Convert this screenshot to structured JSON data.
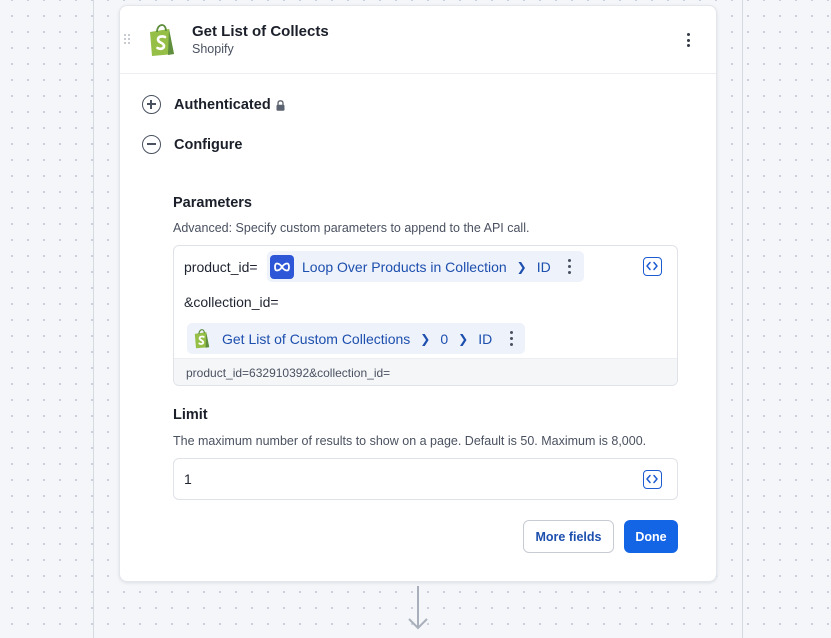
{
  "step": {
    "title": "Get List of Collects",
    "app": "Shopify",
    "menu_icon": "kebab-icon"
  },
  "sections": {
    "authenticated": {
      "label": "Authenticated",
      "state": "collapsed",
      "icon": "lock-icon"
    },
    "configure": {
      "label": "Configure",
      "state": "expanded"
    }
  },
  "parameters": {
    "label": "Parameters",
    "help": "Advanced: Specify custom parameters to append to the API call.",
    "prefix_product": "product_id=",
    "pill1": {
      "icon": "loop-icon",
      "label": "Loop Over Products in Collection",
      "path": [
        "ID"
      ]
    },
    "prefix_collection": "&collection_id=",
    "pill2": {
      "icon": "shopify-icon",
      "label": "Get List of Custom Collections",
      "path": [
        "0",
        "ID"
      ]
    },
    "preview": "product_id=632910392&collection_id="
  },
  "limit": {
    "label": "Limit",
    "help": "The maximum number of results to show on a page. Default is 50. Maximum is 8,000.",
    "value": "1"
  },
  "buttons": {
    "more_fields": "More fields",
    "done": "Done"
  },
  "colors": {
    "primary": "#1464e6",
    "pill_background": "#eef2fb",
    "pill_text": "#1d4fae",
    "shopify_green": "#95bf47"
  }
}
